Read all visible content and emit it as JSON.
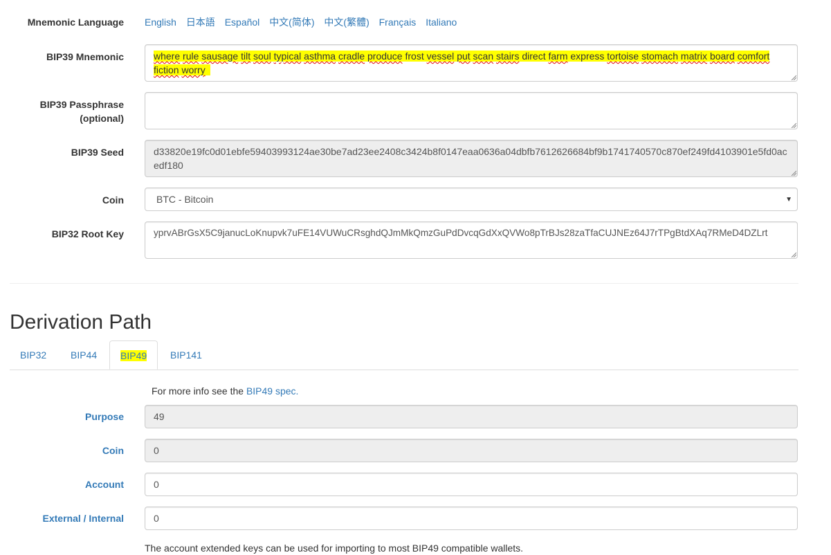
{
  "mnemonic_language": {
    "label": "Mnemonic Language",
    "options": [
      "English",
      "日本語",
      "Español",
      "中文(简体)",
      "中文(繁體)",
      "Français",
      "Italiano"
    ]
  },
  "bip39_mnemonic": {
    "label": "BIP39 Mnemonic",
    "words": [
      "where",
      "rule",
      "sausage",
      "tilt",
      "soul",
      "typical",
      "asthma",
      "cradle",
      "produce",
      "frost",
      "vessel",
      "put",
      "scan",
      "stairs",
      "direct",
      "farm",
      "express",
      "tortoise",
      "stomach",
      "matrix",
      "board",
      "comfort",
      "fiction",
      "worry"
    ]
  },
  "bip39_passphrase": {
    "label_line1": "BIP39 Passphrase",
    "label_line2": "(optional)",
    "value": ""
  },
  "bip39_seed": {
    "label": "BIP39 Seed",
    "line1": "d33820e19fc0d01ebfe59403993124ae30be7ad23ee2408c3424b8f0147eaa0636a04dbfb7612626684bf9b1741740570c870ef249fd4103901e5fd0ac",
    "line2": "edf180"
  },
  "coin": {
    "label": "Coin",
    "selected": "BTC - Bitcoin"
  },
  "bip32_root_key": {
    "label": "BIP32 Root Key",
    "value": "yprvABrGsX5C9janucLoKnupvk7uFE14VUWuCRsghdQJmMkQmzGuPdDvcqGdXxQVWo8pTrBJs28zaTfaCUJNEz64J7rTPgBtdXAq7RMeD4DZLrt"
  },
  "derivation_path": {
    "title": "Derivation Path",
    "tabs": [
      "BIP32",
      "BIP44",
      "BIP49",
      "BIP141"
    ],
    "active_tab": "BIP49",
    "info_prefix": "For more info see the ",
    "info_link": "BIP49 spec.",
    "purpose": {
      "label": "Purpose",
      "value": "49"
    },
    "coin": {
      "label": "Coin",
      "value": "0"
    },
    "account": {
      "label": "Account",
      "value": "0"
    },
    "external_internal": {
      "label": "External / Internal",
      "value": "0"
    },
    "footer_text": "The account extended keys can be used for importing to most BIP49 compatible wallets."
  },
  "colors": {
    "link": "#337ab7",
    "highlight": "#ffff00",
    "readonly_bg": "#eeeeee"
  }
}
